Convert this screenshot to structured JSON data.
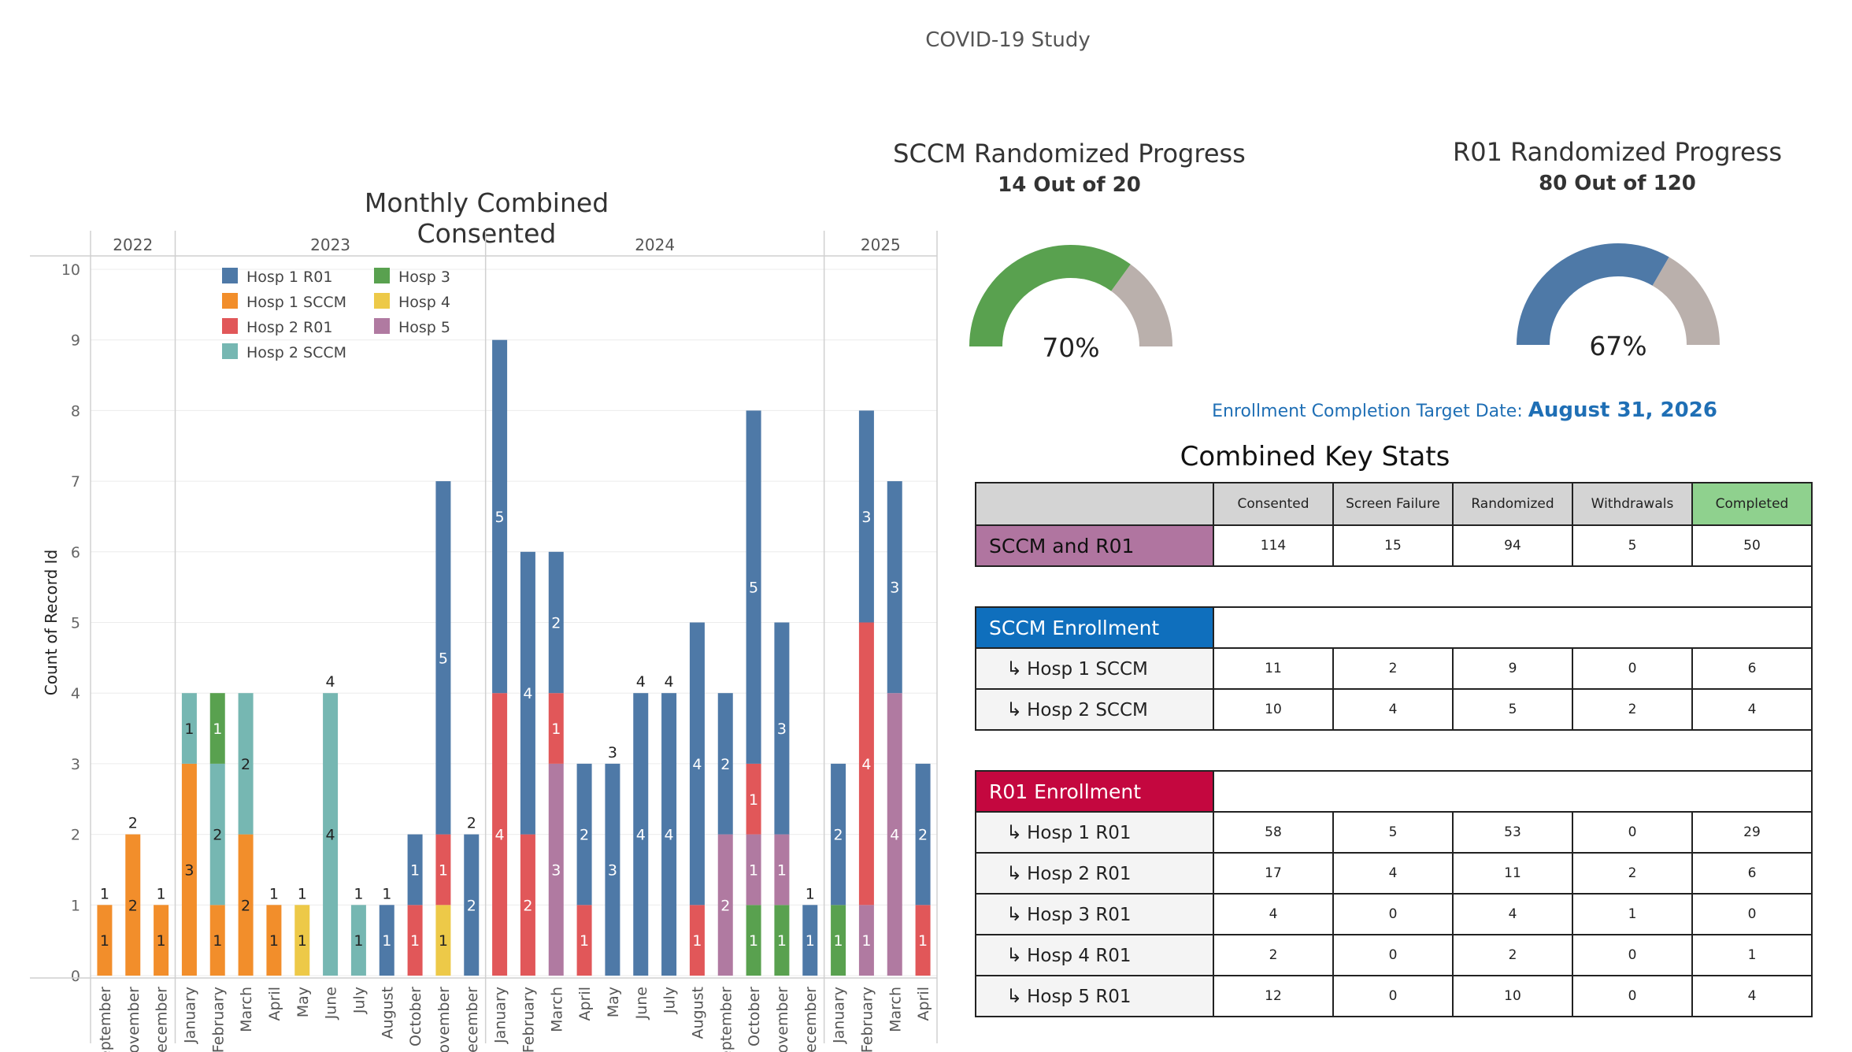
{
  "page": {
    "title": "COVID-19 Study"
  },
  "chart_data": {
    "type": "bar",
    "stacked": true,
    "title": "Monthly Combined Consented",
    "ylabel": "Count of Record Id",
    "ylim": [
      0,
      10
    ],
    "yticks": [
      0,
      1,
      2,
      3,
      4,
      5,
      6,
      7,
      8,
      9,
      10
    ],
    "years": [
      {
        "label": "2022",
        "from": 0,
        "to": 2
      },
      {
        "label": "2023",
        "from": 3,
        "to": 13
      },
      {
        "label": "2024",
        "from": 14,
        "to": 25
      },
      {
        "label": "2025",
        "from": 26,
        "to": 29
      }
    ],
    "categories": [
      "September",
      "November",
      "December",
      "January",
      "February",
      "March",
      "April",
      "May",
      "June",
      "July",
      "August",
      "October",
      "November",
      "December",
      "January",
      "February",
      "March",
      "April",
      "May",
      "June",
      "July",
      "August",
      "September",
      "October",
      "November",
      "December",
      "January",
      "February",
      "March",
      "April"
    ],
    "series": [
      {
        "name": "Hosp 1 SCCM",
        "color": "#f28e2b",
        "values": [
          1,
          2,
          1,
          3,
          1,
          2,
          1,
          0,
          0,
          0,
          0,
          0,
          0,
          0,
          0,
          0,
          0,
          0,
          0,
          0,
          0,
          0,
          0,
          0,
          0,
          0,
          0,
          0,
          0,
          0
        ]
      },
      {
        "name": "Hosp 2 SCCM",
        "color": "#76b7b2",
        "values": [
          0,
          0,
          0,
          1,
          2,
          2,
          0,
          0,
          4,
          1,
          0,
          0,
          0,
          0,
          0,
          0,
          0,
          0,
          0,
          0,
          0,
          0,
          0,
          0,
          0,
          0,
          0,
          0,
          0,
          0
        ]
      },
      {
        "name": "Hosp 4",
        "color": "#edc948",
        "values": [
          0,
          0,
          0,
          0,
          0,
          0,
          0,
          1,
          0,
          0,
          0,
          0,
          1,
          0,
          0,
          0,
          0,
          0,
          0,
          0,
          0,
          0,
          0,
          0,
          0,
          0,
          0,
          0,
          0,
          0
        ]
      },
      {
        "name": "Hosp 3",
        "color": "#59a14f",
        "values": [
          0,
          0,
          0,
          0,
          1,
          0,
          0,
          0,
          0,
          0,
          0,
          0,
          0,
          0,
          0,
          0,
          0,
          0,
          0,
          0,
          0,
          0,
          0,
          1,
          1,
          0,
          1,
          0,
          0,
          0
        ]
      },
      {
        "name": "Hosp 5",
        "color": "#b07aa1",
        "values": [
          0,
          0,
          0,
          0,
          0,
          0,
          0,
          0,
          0,
          0,
          0,
          0,
          0,
          0,
          0,
          0,
          3,
          0,
          0,
          0,
          0,
          0,
          2,
          1,
          1,
          0,
          0,
          1,
          4,
          0
        ]
      },
      {
        "name": "Hosp 2 R01",
        "color": "#e15759",
        "values": [
          0,
          0,
          0,
          0,
          0,
          0,
          0,
          0,
          0,
          0,
          0,
          1,
          1,
          0,
          4,
          2,
          1,
          1,
          0,
          0,
          0,
          1,
          0,
          1,
          0,
          0,
          0,
          4,
          0,
          1
        ]
      },
      {
        "name": "Hosp 1 R01",
        "color": "#4e79a7",
        "values": [
          0,
          0,
          0,
          0,
          0,
          0,
          0,
          0,
          0,
          0,
          1,
          1,
          5,
          2,
          5,
          4,
          2,
          2,
          3,
          4,
          4,
          4,
          2,
          5,
          3,
          1,
          2,
          3,
          3,
          2
        ]
      }
    ],
    "legend": {
      "placement": "top-left",
      "order": [
        "Hosp 1 R01",
        "Hosp 3",
        "Hosp 1 SCCM",
        "Hosp 4",
        "Hosp 2 R01",
        "Hosp 5",
        "Hosp 2 SCCM"
      ]
    }
  },
  "gauges": {
    "sccm": {
      "title": "SCCM Randomized Progress",
      "subtitle": "14 Out of 20",
      "percent_label": "70%",
      "fraction": 0.7,
      "fill_color": "#59a14f",
      "rest_color": "#bab0ac"
    },
    "r01": {
      "title": "R01 Randomized Progress",
      "subtitle": "80 Out of 120",
      "percent_label": "67%",
      "fraction": 0.667,
      "fill_color": "#4e79a7",
      "rest_color": "#bab0ac"
    }
  },
  "enrollment_target": {
    "label": "Enrollment Completion Target Date:",
    "date": "August 31, 2026"
  },
  "stats": {
    "title": "Combined Key Stats",
    "headers": [
      "Consented",
      "Screen Failure",
      "Randomized",
      "Withdrawals",
      "Completed"
    ],
    "combined": {
      "label": "SCCM and R01",
      "values": [
        "114",
        "15",
        "94",
        "5",
        "50"
      ]
    },
    "sccm": {
      "label": "SCCM Enrollment",
      "rows": [
        {
          "label": "Hosp 1 SCCM",
          "values": [
            "11",
            "2",
            "9",
            "0",
            "6"
          ]
        },
        {
          "label": "Hosp 2 SCCM",
          "values": [
            "10",
            "4",
            "5",
            "2",
            "4"
          ]
        }
      ]
    },
    "r01": {
      "label": "R01 Enrollment",
      "rows": [
        {
          "label": "Hosp 1 R01",
          "values": [
            "58",
            "5",
            "53",
            "0",
            "29"
          ]
        },
        {
          "label": "Hosp 2 R01",
          "values": [
            "17",
            "4",
            "11",
            "2",
            "6"
          ]
        },
        {
          "label": "Hosp 3 R01",
          "values": [
            "4",
            "0",
            "4",
            "1",
            "0"
          ]
        },
        {
          "label": "Hosp 4 R01",
          "values": [
            "2",
            "0",
            "2",
            "0",
            "1"
          ]
        },
        {
          "label": "Hosp 5 R01",
          "values": [
            "12",
            "0",
            "10",
            "0",
            "4"
          ]
        }
      ]
    },
    "arrow_glyph": "↳"
  }
}
